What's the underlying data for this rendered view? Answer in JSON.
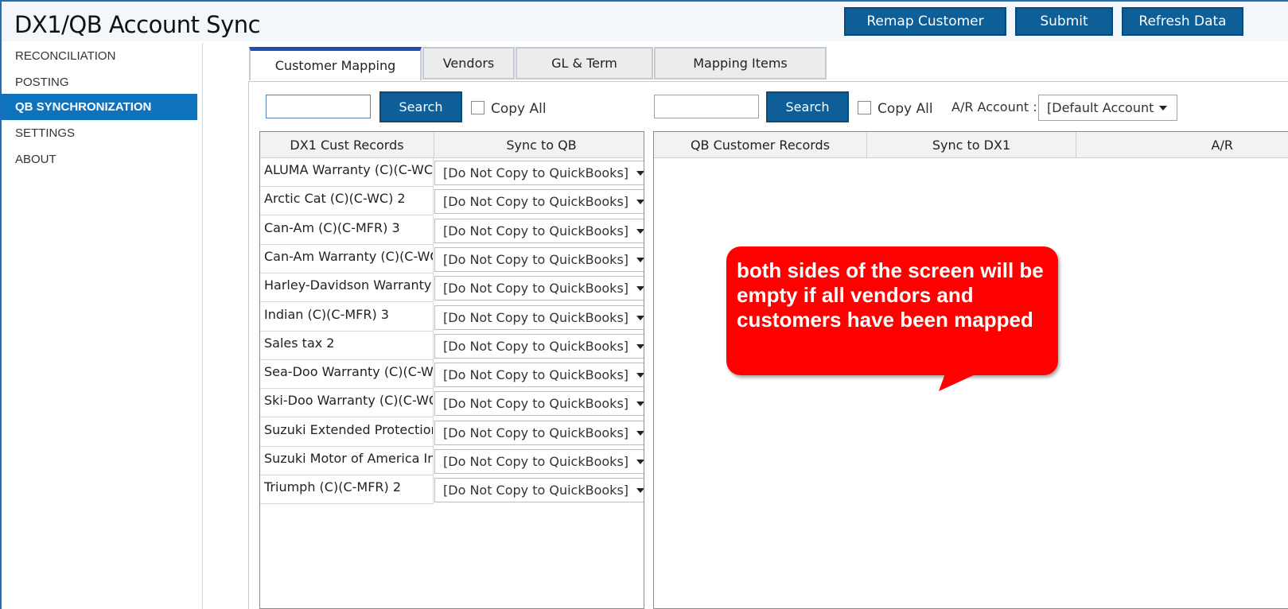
{
  "app": {
    "title": "DX1/QB Account Sync"
  },
  "header_buttons": {
    "remap": "Remap Customer",
    "submit": "Submit",
    "refresh": "Refresh Data"
  },
  "nav": {
    "items": [
      {
        "label": "RECONCILIATION",
        "active": false
      },
      {
        "label": "POSTING",
        "active": false
      },
      {
        "label": "QB SYNCHRONIZATION",
        "active": true
      },
      {
        "label": "SETTINGS",
        "active": false
      },
      {
        "label": "ABOUT",
        "active": false
      }
    ]
  },
  "tabs": [
    {
      "label": "Customer Mapping",
      "active": true
    },
    {
      "label": "Vendors",
      "active": false
    },
    {
      "label": "GL & Term",
      "active": false
    },
    {
      "label": "Mapping Items",
      "active": false
    }
  ],
  "left_toolbar": {
    "search_value": "",
    "search_button": "Search",
    "copy_all": "Copy All"
  },
  "right_toolbar": {
    "search_value": "",
    "search_button": "Search",
    "copy_all": "Copy All",
    "ar_label": "A/R Account :",
    "ar_value": "[Default Account"
  },
  "left_grid": {
    "columns": [
      "DX1 Cust Records",
      "Sync to QB"
    ],
    "rows": [
      {
        "name": "ALUMA Warranty (C)(C-WC",
        "sync": "[Do Not Copy to QuickBooks]"
      },
      {
        "name": "Arctic Cat (C)(C-WC) 2",
        "sync": "[Do Not Copy to QuickBooks]"
      },
      {
        "name": "Can-Am (C)(C-MFR) 3",
        "sync": "[Do Not Copy to QuickBooks]"
      },
      {
        "name": "Can-Am Warranty (C)(C-WC",
        "sync": "[Do Not Copy to QuickBooks]"
      },
      {
        "name": "Harley-Davidson Warranty",
        "sync": "[Do Not Copy to QuickBooks]"
      },
      {
        "name": "Indian (C)(C-MFR) 3",
        "sync": "[Do Not Copy to QuickBooks]"
      },
      {
        "name": "Sales tax 2",
        "sync": "[Do Not Copy to QuickBooks]"
      },
      {
        "name": "Sea-Doo Warranty (C)(C-W",
        "sync": "[Do Not Copy to QuickBooks]"
      },
      {
        "name": "Ski-Doo Warranty (C)(C-WC",
        "sync": "[Do Not Copy to QuickBooks]"
      },
      {
        "name": "Suzuki Extended Protection",
        "sync": "[Do Not Copy to QuickBooks]"
      },
      {
        "name": "Suzuki Motor of America In",
        "sync": "[Do Not Copy to QuickBooks]"
      },
      {
        "name": "Triumph (C)(C-MFR) 2",
        "sync": "[Do Not Copy to QuickBooks]"
      }
    ]
  },
  "right_grid": {
    "columns": [
      "QB Customer Records",
      "Sync to DX1",
      "A/R"
    ]
  },
  "callout": {
    "text": "both sides of the screen will be empty if all vendors and customers have been mapped",
    "color": "#ff0000"
  },
  "colors": {
    "accent": "#0e5e97",
    "nav_active": "#0e72bd"
  }
}
